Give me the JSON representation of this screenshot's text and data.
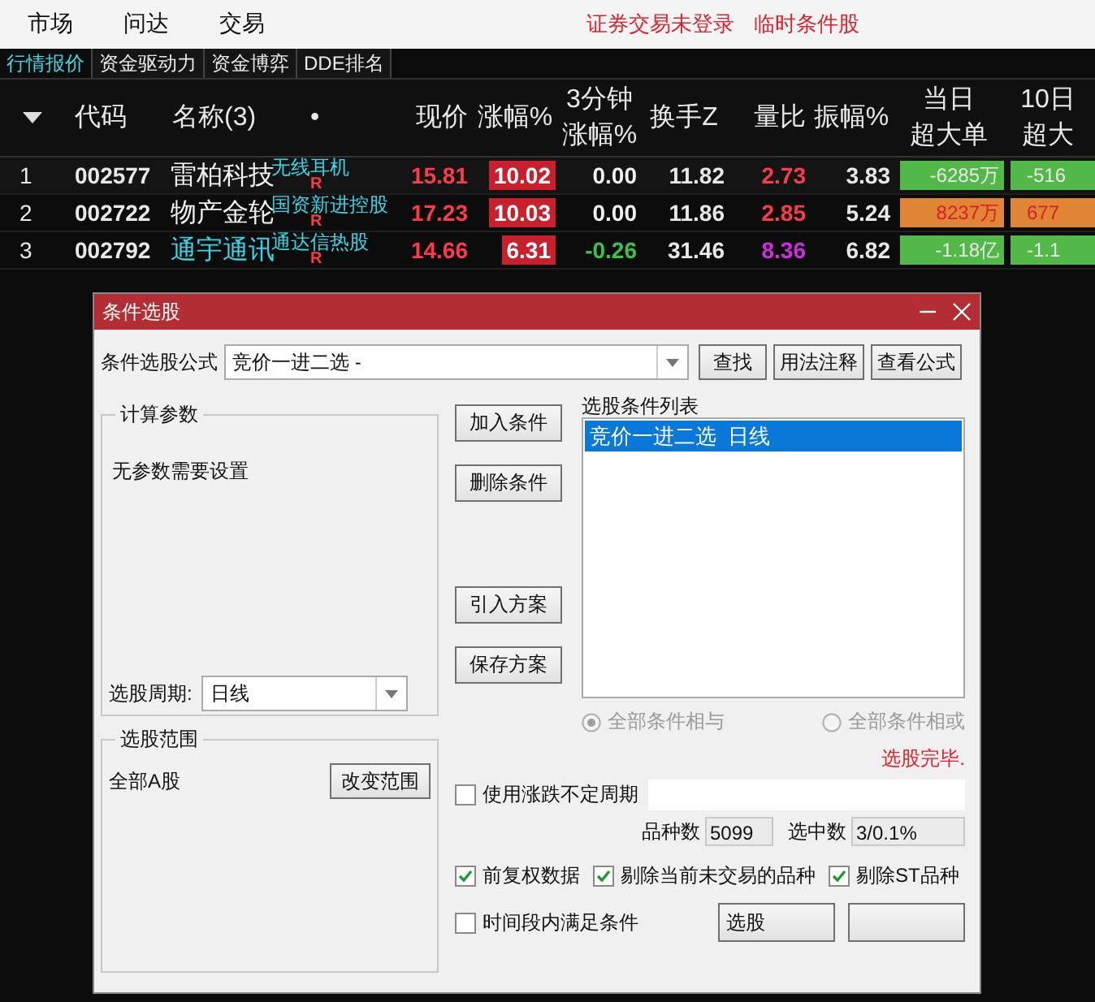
{
  "menu": [
    "市场",
    "问达",
    "交易"
  ],
  "status": [
    "证券交易未登录",
    "临时条件股"
  ],
  "tabs": [
    {
      "label": "行情报价",
      "selected": true
    },
    {
      "label": "资金驱动力",
      "selected": false
    },
    {
      "label": "资金博弈",
      "selected": false
    },
    {
      "label": "DDE排名",
      "selected": false
    }
  ],
  "table": {
    "columns": [
      {
        "lines": [
          "代码"
        ]
      },
      {
        "lines": [
          "名称(3)"
        ]
      },
      {
        "lines": [
          "•"
        ]
      },
      {
        "lines": [
          "现价"
        ]
      },
      {
        "lines": [
          "涨幅%"
        ]
      },
      {
        "lines": [
          "3分钟",
          "涨幅%"
        ]
      },
      {
        "lines": [
          "换手Z"
        ]
      },
      {
        "lines": [
          "量比"
        ]
      },
      {
        "lines": [
          "振幅%"
        ]
      },
      {
        "lines": [
          "当日",
          "超大单"
        ]
      },
      {
        "lines": [
          "10日",
          "超大"
        ]
      }
    ],
    "rows": [
      {
        "index": "1",
        "code": "002577",
        "name": "雷柏科技",
        "name_highlight": false,
        "tag": "无线耳机",
        "mark": "R",
        "price": "15.81",
        "change": "10.02",
        "change_3min": {
          "text": "0.00",
          "color": "#f0f0f0"
        },
        "turnover": "11.82",
        "vol_ratio": {
          "text": "2.73",
          "color": "#ff3a4a"
        },
        "amplitude": "3.83",
        "big_order": {
          "text": "-6285万",
          "color": "#52b848"
        },
        "big_order_10d": {
          "text": "-516",
          "color": "#52b848"
        }
      },
      {
        "index": "2",
        "code": "002722",
        "name": "物产金轮",
        "name_highlight": false,
        "tag": "国资新进控股",
        "mark": "R",
        "price": "17.23",
        "change": "10.03",
        "change_3min": {
          "text": "0.00",
          "color": "#f0f0f0"
        },
        "turnover": "11.86",
        "vol_ratio": {
          "text": "2.85",
          "color": "#ff3a4a"
        },
        "amplitude": "5.24",
        "big_order": {
          "text": "8237万",
          "color": "#e08436"
        },
        "big_order_10d": {
          "text": "677",
          "color": "#e08436"
        }
      },
      {
        "index": "3",
        "code": "002792",
        "name": "通宇通讯",
        "name_highlight": true,
        "tag": "通达信热股",
        "mark": "R",
        "price": "14.66",
        "change": "6.31",
        "change_3min": {
          "text": "-0.26",
          "color": "#3ac24a"
        },
        "turnover": "31.46",
        "vol_ratio": {
          "text": "8.36",
          "color": "#d02ce0"
        },
        "amplitude": "6.82",
        "big_order": {
          "text": "-1.18亿",
          "color": "#52b848"
        },
        "big_order_10d": {
          "text": "-1.1",
          "color": "#52b848"
        }
      }
    ]
  },
  "dialog": {
    "title": "条件选股",
    "formula_label": "条件选股公式",
    "formula_value": "竞价一进二选 -",
    "top_buttons": [
      "查找",
      "用法注释",
      "查看公式"
    ],
    "params_group": "计算参数",
    "params_text": "无参数需要设置",
    "period_label": "选股周期:",
    "period_value": "日线",
    "scope_group": "选股范围",
    "scope_value": "全部A股",
    "scope_button": "改变范围",
    "side_buttons": [
      "加入条件",
      "删除条件",
      "引入方案",
      "保存方案"
    ],
    "list_label": "选股条件列表",
    "list_items": [
      {
        "label": "竞价一进二选  日线",
        "selected": true
      }
    ],
    "logic": [
      {
        "label": "全部条件相与",
        "selected": true,
        "disabled": true
      },
      {
        "label": "全部条件相或",
        "selected": false,
        "disabled": true
      }
    ],
    "result": "选股完毕.",
    "variable_period": {
      "label": "使用涨跌不定周期",
      "checked": false
    },
    "count_label": "品种数",
    "count_value": "5099",
    "selected_label": "选中数",
    "selected_value": "3/0.1%",
    "options": [
      {
        "label": "前复权数据",
        "checked": true
      },
      {
        "label": "剔除当前未交易的品种",
        "checked": true
      },
      {
        "label": "剔除ST品种",
        "checked": true
      }
    ],
    "time_range": {
      "label": "时间段内满足条件",
      "checked": false
    },
    "run_button": "选股"
  }
}
